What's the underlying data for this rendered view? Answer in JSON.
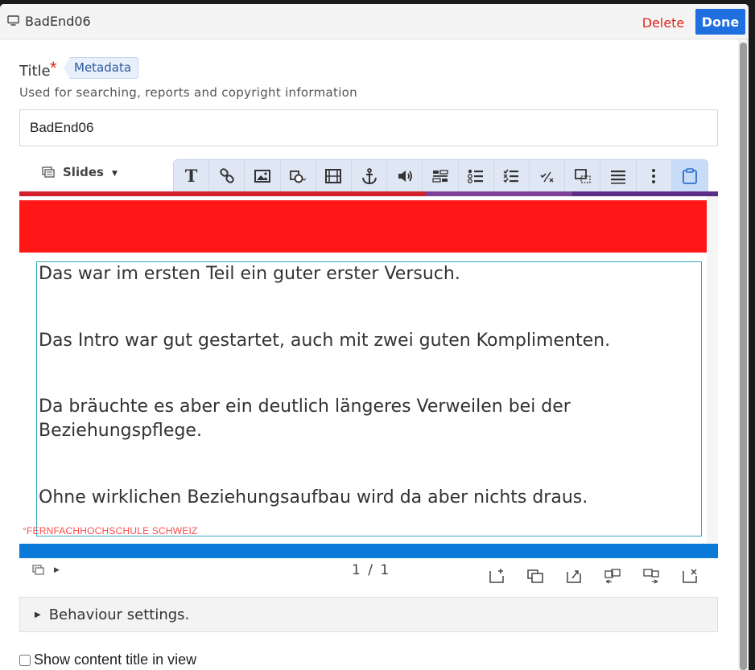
{
  "header": {
    "title": "BadEnd06",
    "delete_label": "Delete",
    "done_label": "Done"
  },
  "form": {
    "title_label": "Title",
    "required_mark": "*",
    "metadata_label": "Metadata",
    "description": "Used for searching, reports and copyright information",
    "title_value": "BadEnd06"
  },
  "slides_menu": {
    "label": "Slides"
  },
  "toolbar": {
    "items": [
      "text-icon",
      "link-icon",
      "image-icon",
      "shapes-icon",
      "video-icon",
      "anchor-icon",
      "audio-icon",
      "fill-in-blanks-icon",
      "single-choice-icon",
      "multiple-choice-icon",
      "true-false-icon",
      "drag-drop-icon",
      "summary-icon",
      "more-icon",
      "paste-icon"
    ]
  },
  "slide": {
    "paragraphs": [
      "Das war im ersten Teil ein guter erster Versuch.",
      "Das Intro war gut gestartet, auch mit zwei guten Komplimenten.",
      "Da bräuchte es aber ein deutlich längeres Verweilen bei der",
      "Beziehungspflege.",
      "Ohne wirklichen Beziehungsaufbau wird da aber nichts draus."
    ],
    "footer_mark": "°FERNFACHHOCHSCHULE SCHWEIZ",
    "colors": {
      "banner": "#ff1616",
      "bottom_bar": "#0a79d8",
      "frame": "#35a6b7"
    }
  },
  "navigation": {
    "page": "1",
    "separator": "/",
    "total": "1"
  },
  "behaviour": {
    "label": "Behaviour settings."
  },
  "show_title": {
    "label": "Show content title in view",
    "checked": false
  }
}
